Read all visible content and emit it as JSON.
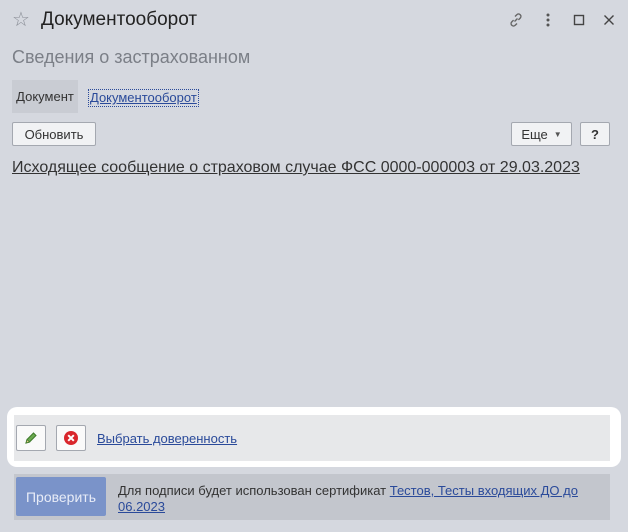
{
  "window": {
    "title": "Документооборот"
  },
  "form": {
    "subtitle": "Сведения о застрахованном"
  },
  "tabs": {
    "document_label": "Документ",
    "workflow_link": "Документооборот"
  },
  "toolbar": {
    "refresh_label": "Обновить",
    "more_label": "Еще",
    "help_label": "?"
  },
  "message": {
    "link_text": "Исходящее сообщение о страховом случае ФСС 0000-000003 от 29.03.2023"
  },
  "power_of_attorney": {
    "select_link": "Выбрать доверенность"
  },
  "footer": {
    "check_label": "Проверить",
    "sign_text": "Для подписи будет использован сертификат ",
    "certificate_link": "Тестов, Тесты входящих ДО до 06.2023"
  },
  "icons": {
    "favorite": "star-icon",
    "link": "link-icon",
    "menu": "more-vertical-icon",
    "maximize": "maximize-icon",
    "close": "close-icon",
    "edit": "pencil-icon",
    "remove": "red-x-circle-icon"
  }
}
